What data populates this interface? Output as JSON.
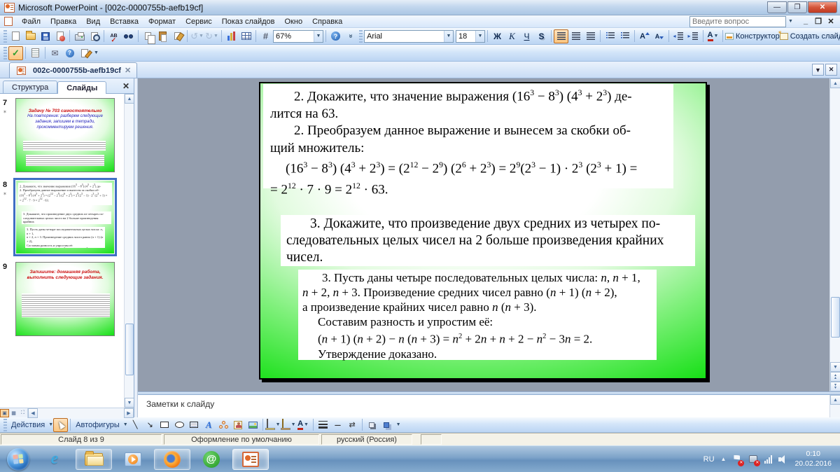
{
  "window": {
    "title": "Microsoft PowerPoint - [002c-0000755b-aefb19cf]"
  },
  "menu": {
    "items": [
      "Файл",
      "Правка",
      "Вид",
      "Вставка",
      "Формат",
      "Сервис",
      "Показ слайдов",
      "Окно",
      "Справка"
    ],
    "question_placeholder": "Введите вопрос"
  },
  "toolbar_main": {
    "zoom": "67%"
  },
  "toolbar_format": {
    "font": "Arial",
    "size": "18",
    "bold": "Ж",
    "italic": "К",
    "underline": "Ч",
    "shadow": "S",
    "designer": "Конструктор",
    "new_slide": "Создать слайд"
  },
  "doc_tab": "002c-0000755b-aefb19cf",
  "panel": {
    "tab_outline": "Структура",
    "tab_slides": "Слайды",
    "slides": [
      {
        "number": "7",
        "title": "Задачу № 703 самостоятельно",
        "body": "На повторение: разберем следующие задания, запишем в тетради, прокомментируем решения."
      },
      {
        "number": "8"
      },
      {
        "number": "9",
        "title": "Запишите: домашняя работа, выполнить следующие задания."
      }
    ]
  },
  "slide": {
    "blocks": [
      [
        "2. Докажите, что значение выражения (16^{3} − 8^{3}) (4^{3} + 2^{3}) де-",
        "лится на 63.",
        "2. Преобразуем данное выражение и вынесем за скобки об-",
        "щий множитель:",
        "(16^{3} − 8^{3}) (4^{3} + 2^{3}) = (2^{12} − 2^{9}) (2^{6} + 2^{3}) = 2^{9}(2^{3} − 1) · 2^{3} (2^{3} + 1) =",
        "= 2^{12} · 7 · 9 = 2^{12} · 63."
      ],
      [
        "3. Докажите, что произведение двух средних из четырех по-",
        "следовательных целых чисел на 2 больше произведения крайних",
        "чисел."
      ],
      [
        "3. Пусть даны четыре последовательных целых числа: *n*, *n* + 1,",
        "*n* + 2, *n* + 3. Произведение средних чисел равно (*n* + 1) (*n* + 2),",
        "а произведение крайних чисел равно *n* (*n* + 3).",
        "Составим разность и упростим её:",
        "(*n* + 1) (*n* + 2) − *n* (*n* + 3) = *n*^{2} + 2*n* + *n* + 2 − *n*^{2} − 3*n* = 2.",
        "Утверждение доказано."
      ]
    ]
  },
  "notes": {
    "placeholder": "Заметки к слайду"
  },
  "drawbar": {
    "actions": "Действия",
    "autoshapes": "Автофигуры"
  },
  "status": {
    "slide": "Слайд 8 из 9",
    "design": "Оформление по умолчанию",
    "lang": "русский (Россия)"
  },
  "tray": {
    "lang": "RU",
    "time": "0:10",
    "date": "20.02.2016"
  }
}
